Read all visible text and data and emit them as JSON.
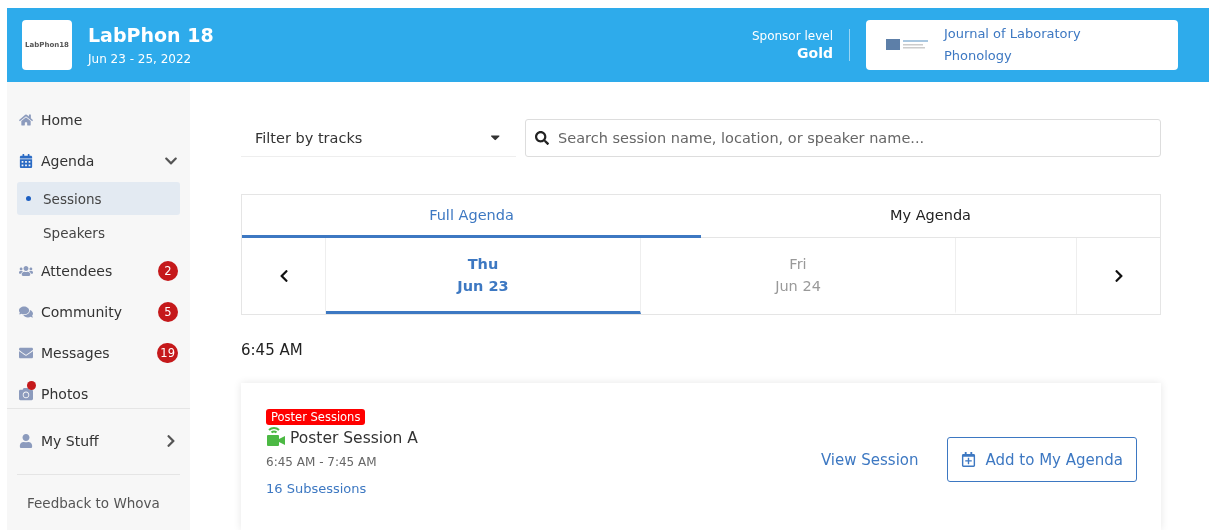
{
  "event": {
    "title": "LabPhon 18",
    "dates": "Jun 23 - 25, 2022",
    "logo_text": "LabPhon18"
  },
  "sponsor": {
    "label": "Sponsor level",
    "level": "Gold",
    "name": "Journal of Laboratory Phonology"
  },
  "sidebar": {
    "items": [
      {
        "label": "Home",
        "selected": false
      },
      {
        "label": "Agenda",
        "selected": false,
        "expanded": true,
        "children": [
          {
            "label": "Sessions",
            "selected": true
          },
          {
            "label": "Speakers",
            "selected": false
          }
        ]
      },
      {
        "label": "Attendees",
        "selected": false,
        "badge": "2"
      },
      {
        "label": "Community",
        "selected": false,
        "badge": "5"
      },
      {
        "label": "Messages",
        "selected": false,
        "badge": "19"
      },
      {
        "label": "Photos",
        "selected": false,
        "dot": true
      }
    ],
    "my_stuff": {
      "label": "My Stuff"
    },
    "feedback": "Feedback to Whova"
  },
  "filter": {
    "value": "Filter by tracks"
  },
  "search": {
    "placeholder": "Search session name, location, or speaker name..."
  },
  "tabs": [
    {
      "label": "Full Agenda",
      "selected": true
    },
    {
      "label": "My Agenda",
      "selected": false
    }
  ],
  "days": [
    {
      "weekday": "Thu",
      "date": "Jun 23",
      "selected": true
    },
    {
      "weekday": "Fri",
      "date": "Jun 24",
      "selected": false
    }
  ],
  "time": "6:45 AM",
  "sessions": [
    {
      "tag": "Poster Sessions",
      "title": "Poster Session A",
      "live": true,
      "time": "6:45 AM - 7:45 AM",
      "subsessions": "16 Subsessions",
      "view": "View Session",
      "add": "Add to My Agenda"
    }
  ]
}
